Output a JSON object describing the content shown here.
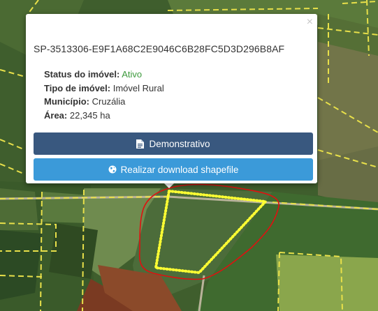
{
  "popup": {
    "close_label": "×",
    "property_code": "SP-3513306-E9F1A68C2E9046C6B28FC5D3D296B8AF",
    "attributes": [
      {
        "label": "Status do imóvel:",
        "value": "Ativo"
      },
      {
        "label": "Tipo de imóvel:",
        "value": "Imóvel Rural"
      },
      {
        "label": "Município:",
        "value": "Cruzália"
      },
      {
        "label": "Área:",
        "value": "22,345 ha"
      }
    ],
    "buttons": {
      "demonstrativo_label": "Demonstrativo",
      "download_label": "Realizar download shapefile"
    },
    "icons": {
      "demonstrativo": "file-text-icon",
      "download": "globe-icon",
      "close": "close-icon"
    }
  },
  "colors": {
    "demonstrativo_button": "#39587f",
    "download_button": "#3b9ad9",
    "status_active": "#3c9a3c",
    "selected_parcel_outline": "#ffff33",
    "highlight_outline": "#e01010",
    "parcel_boundaries": "#e8e04a"
  }
}
